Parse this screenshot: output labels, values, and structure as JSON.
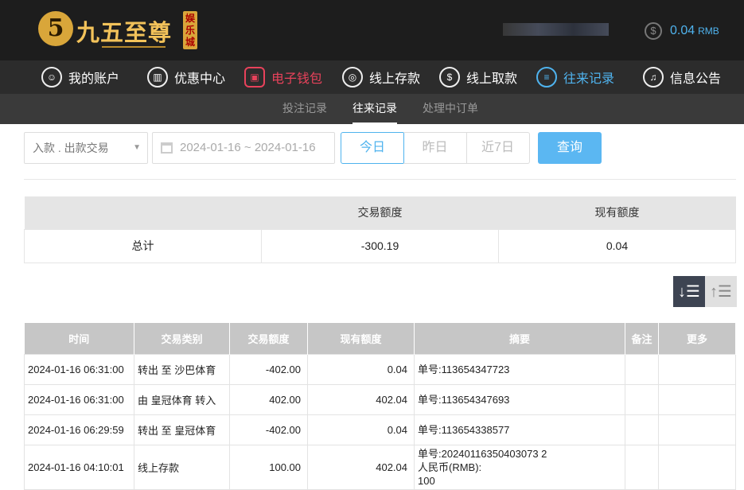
{
  "header": {
    "logo_number": "5",
    "logo_text": "九五至尊",
    "logo_sub": "娱乐城",
    "balance_value": "0.04",
    "balance_unit": "RMB"
  },
  "nav": [
    {
      "label": "我的账户",
      "icon": "user-icon",
      "glyph": "☺"
    },
    {
      "label": "优惠中心",
      "icon": "gift-icon",
      "glyph": "▥"
    },
    {
      "label": "电子钱包",
      "icon": "wallet-icon",
      "glyph": "▣"
    },
    {
      "label": "线上存款",
      "icon": "deposit-icon",
      "glyph": "◎"
    },
    {
      "label": "线上取款",
      "icon": "withdraw-icon",
      "glyph": "$"
    },
    {
      "label": "往来记录",
      "icon": "records-icon",
      "glyph": "≡"
    },
    {
      "label": "信息公告",
      "icon": "bell-icon",
      "glyph": "♫"
    }
  ],
  "subnav": [
    "投注记录",
    "往来记录",
    "处理中订单"
  ],
  "filters": {
    "type_select": "入款 . 出款交易",
    "date_range": "2024-01-16 ~ 2024-01-16",
    "quick": [
      "今日",
      "昨日",
      "近7日"
    ],
    "query_button": "查询"
  },
  "summary": {
    "headers": [
      "",
      "交易额度",
      "现有额度"
    ],
    "row": [
      "总计",
      "-300.19",
      "0.04"
    ]
  },
  "records": {
    "headers": [
      "时间",
      "交易类别",
      "交易额度",
      "现有额度",
      "摘要",
      "备注",
      "更多"
    ],
    "rows": [
      [
        "2024-01-16 06:31:00",
        "转出 至 沙巴体育",
        "-402.00",
        "0.04",
        "单号:113654347723",
        "",
        ""
      ],
      [
        "2024-01-16 06:31:00",
        "由 皇冠体育 转入",
        "402.00",
        "402.04",
        "单号:113654347693",
        "",
        ""
      ],
      [
        "2024-01-16 06:29:59",
        "转出 至 皇冠体育",
        "-402.00",
        "0.04",
        "单号:113654338577",
        "",
        ""
      ],
      [
        "2024-01-16 04:10:01",
        "线上存款",
        "100.00",
        "402.04",
        "单号:20240116350403073 2\n人民币(RMB):\n100",
        "",
        ""
      ]
    ]
  }
}
